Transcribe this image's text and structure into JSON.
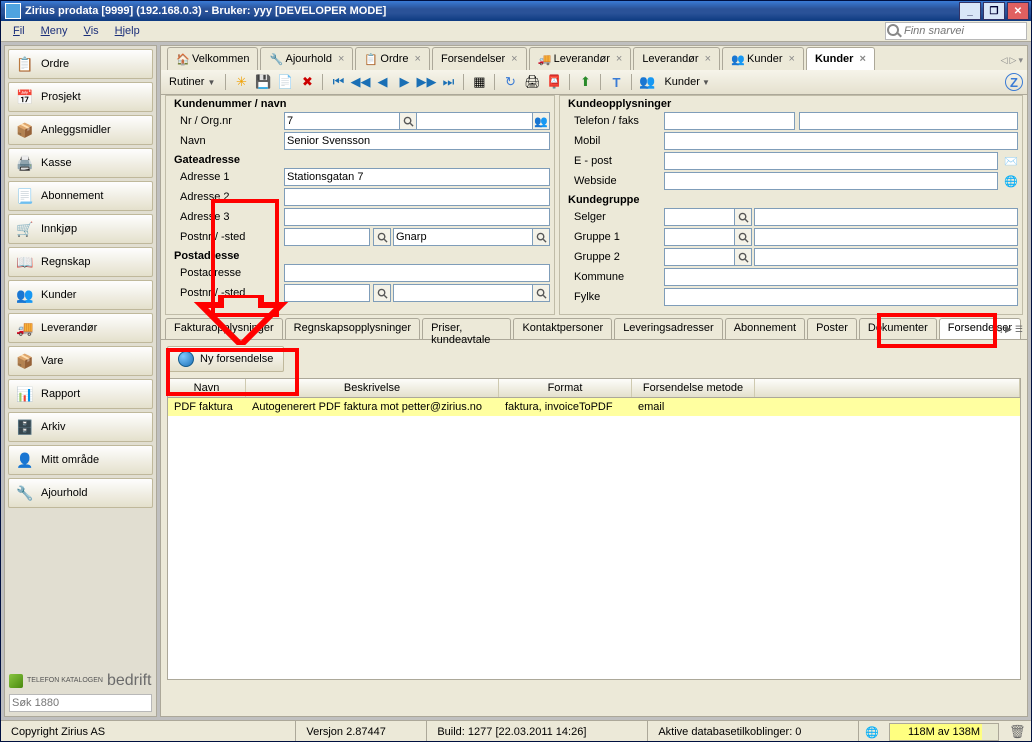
{
  "window_title": "Zirius prodata [9999] (192.168.0.3)  - Bruker: yyy [DEVELOPER MODE]",
  "menubar": {
    "items": [
      "Fil",
      "Meny",
      "Vis",
      "Hjelp"
    ]
  },
  "search_placeholder": "Finn snarvei",
  "sidebar": {
    "items": [
      {
        "label": "Ordre",
        "icon": "📋"
      },
      {
        "label": "Prosjekt",
        "icon": "📅"
      },
      {
        "label": "Anleggsmidler",
        "icon": "📦"
      },
      {
        "label": "Kasse",
        "icon": "🖨️"
      },
      {
        "label": "Abonnement",
        "icon": "📃"
      },
      {
        "label": "Innkjøp",
        "icon": "🛒"
      },
      {
        "label": "Regnskap",
        "icon": "📖"
      },
      {
        "label": "Kunder",
        "icon": "👥"
      },
      {
        "label": "Leverandør",
        "icon": "🚚"
      },
      {
        "label": "Vare",
        "icon": "📦"
      },
      {
        "label": "Rapport",
        "icon": "📊"
      },
      {
        "label": "Arkiv",
        "icon": "🗄️"
      },
      {
        "label": "Mitt område",
        "icon": "👤"
      },
      {
        "label": "Ajourhold",
        "icon": "🔧"
      }
    ],
    "logo_small": "TELEFON KATALOGEN",
    "logo_text": "bedrift",
    "search_placeholder": "Søk 1880"
  },
  "tabs": [
    {
      "label": "Velkommen",
      "icon": "🏠",
      "closable": false
    },
    {
      "label": "Ajourhold",
      "icon": "🔧",
      "closable": true
    },
    {
      "label": "Ordre",
      "icon": "📋",
      "closable": true
    },
    {
      "label": "Forsendelser",
      "icon": "",
      "closable": true
    },
    {
      "label": "Leverandør",
      "icon": "🚚",
      "closable": true
    },
    {
      "label": "Leverandør",
      "icon": "",
      "closable": true
    },
    {
      "label": "Kunder",
      "icon": "👥",
      "closable": true
    },
    {
      "label": "Kunder",
      "icon": "",
      "closable": true,
      "active": true
    }
  ],
  "toolbar": {
    "rutiner_label": "Rutiner",
    "dropdown_label": "Kunder"
  },
  "form_left": {
    "title": "Kundenummer / navn",
    "nrorg": "Nr / Org.nr",
    "nrorg_val": "7",
    "navn": "Navn",
    "navn_val": "Senior Svensson",
    "gate": "Gateadresse",
    "adr1": "Adresse 1",
    "adr1_val": "Stationsgatan 7",
    "adr2": "Adresse 2",
    "adr2_val": "",
    "adr3": "Adresse 3",
    "adr3_val": "",
    "postnr": "Postnr / -sted",
    "postnr_val": "",
    "poststed_val": "Gnarp",
    "post": "Postadresse",
    "postadr": "Postadresse",
    "postadr_val": "",
    "postpnr": "Postnr / -sted",
    "postpnr_val": "",
    "postpsted_val": ""
  },
  "form_right": {
    "title": "Kundeopplysninger",
    "telefon": "Telefon / faks",
    "telefon_v": "",
    "faks_v": "",
    "mobil": "Mobil",
    "mobil_v": "",
    "epost": "E - post",
    "epost_v": "",
    "web": "Webside",
    "web_v": "",
    "grp": "Kundegruppe",
    "selger": "Selger",
    "selger_v": "",
    "g1": "Gruppe 1",
    "g1_v": "",
    "g2": "Gruppe 2",
    "g2_v": "",
    "kom": "Kommune",
    "kom_v": "",
    "fylke": "Fylke",
    "fylke_v": ""
  },
  "subtabs": [
    "Fakturaopplysninger",
    "Regnskapsopplysninger",
    "Priser, kundeavtale",
    "Kontaktpersoner",
    "Leveringsadresser",
    "Abonnement",
    "Poster",
    "Dokumenter",
    "Forsendelser"
  ],
  "ny_forsendelse_label": "Ny forsendelse",
  "table": {
    "headers": [
      "Navn",
      "Beskrivelse",
      "Format",
      "Forsendelse metode"
    ],
    "widths": [
      65,
      240,
      120,
      110
    ],
    "rows": [
      [
        "PDF faktura",
        "Autogenerert PDF faktura mot petter@zirius.no",
        "faktura,  invoiceToPDF",
        "email"
      ]
    ]
  },
  "status": {
    "copyright": "Copyright Zirius AS",
    "version": "Versjon 2.87447",
    "build": "Build: 1277 [22.03.2011 14:26]",
    "db": "Aktive databasetilkoblinger: 0",
    "mem": "118M av 138M"
  }
}
